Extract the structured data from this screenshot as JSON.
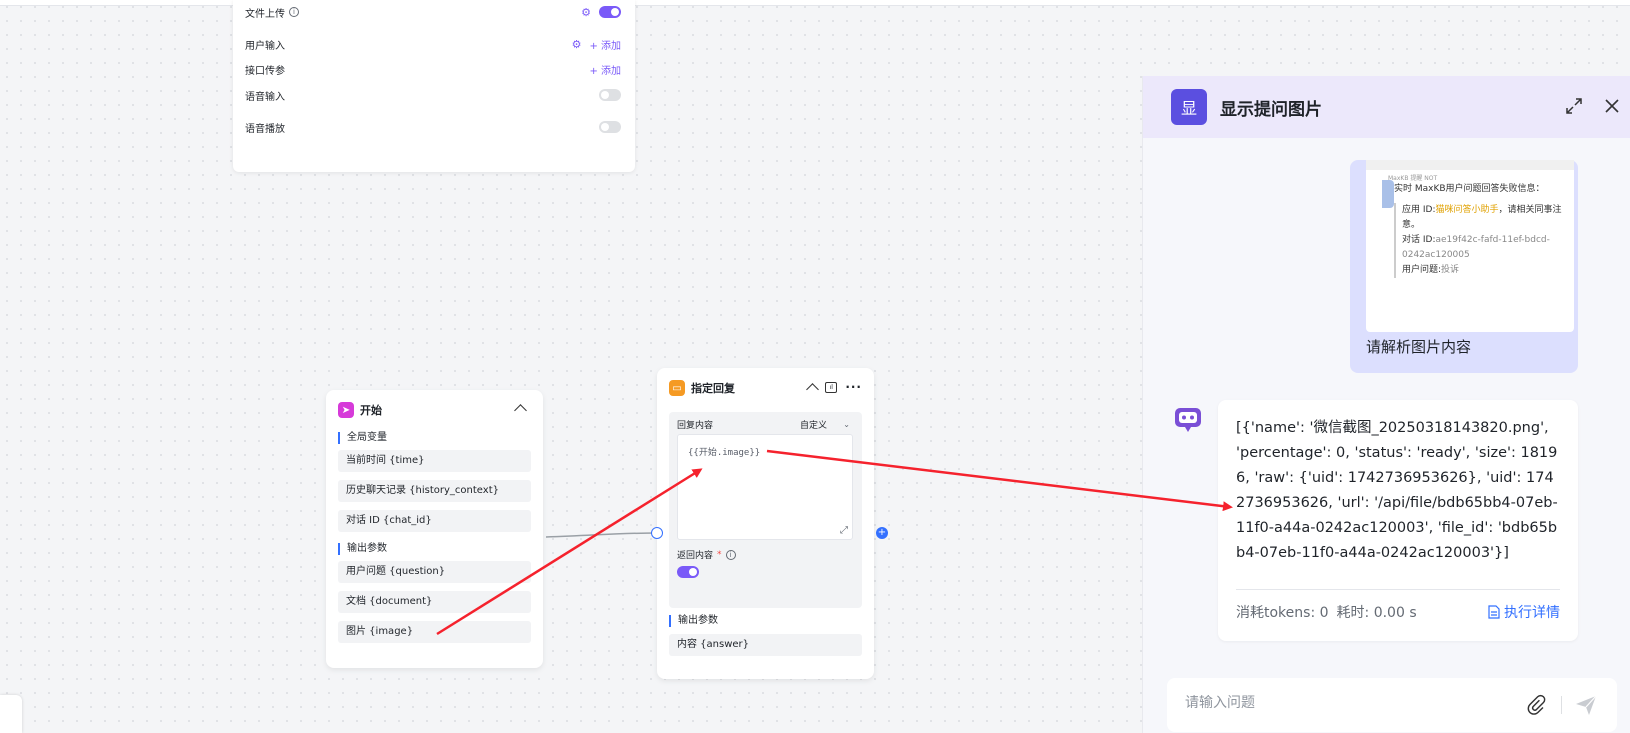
{
  "settings": {
    "file_upload": "文件上传",
    "user_input": "用户输入",
    "api_params": "接口传参",
    "voice_input": "语音输入",
    "voice_play": "语音播放",
    "add_label": "+ 添加"
  },
  "start_node": {
    "title": "开始",
    "global_vars_label": "全局变量",
    "global_vars": [
      "当前时间 {time}",
      "历史聊天记录 {history_context}",
      "对话 ID {chat_id}"
    ],
    "output_label": "输出参数",
    "outputs": [
      "用户问题 {question}",
      "文档 {document}",
      "图片 {image}"
    ]
  },
  "reply_node": {
    "title": "指定回复",
    "content_label": "回复内容",
    "mode": "自定义",
    "template": "{{开始.image}}",
    "return_label": "返回内容",
    "output_label": "输出参数",
    "output": "内容 {answer}"
  },
  "chat": {
    "avatar_char": "显",
    "title": "显示提问图片",
    "screenshot": {
      "meta": "MaxKB 提醒  NOT",
      "line1": "实时 MaxKB用户问题回答失败信息：",
      "app_prefix": "应用 ID:",
      "app_name": "猫咪问答小助手",
      "app_suffix": "，请相关同事注意。",
      "conv_label": "对话 ID:",
      "conv_id": "ae19f42c-fafd-11ef-bdcd-0242ac120005",
      "q_label": "用户问题:",
      "q_value": "投诉"
    },
    "user_message": "请解析图片内容",
    "bot_message": "[{'name': '微信截图_20250318143820.png', 'percentage': 0, 'status': 'ready', 'size': 18196, 'raw': {'uid': 1742736953626}, 'uid': 1742736953626, 'url': '/api/file/bdb65bb4-07eb-11f0-a44a-0242ac120003', 'file_id': 'bdb65bb4-07eb-11f0-a44a-0242ac120003'}]",
    "tokens": "消耗tokens: 0",
    "elapsed": "耗时: 0.00 s",
    "detail_link": "执行详情",
    "input_placeholder": "请输入问题"
  },
  "colors": {
    "accent": "#7a5af8",
    "blue": "#3370ff",
    "arrow": "#f5222d"
  }
}
